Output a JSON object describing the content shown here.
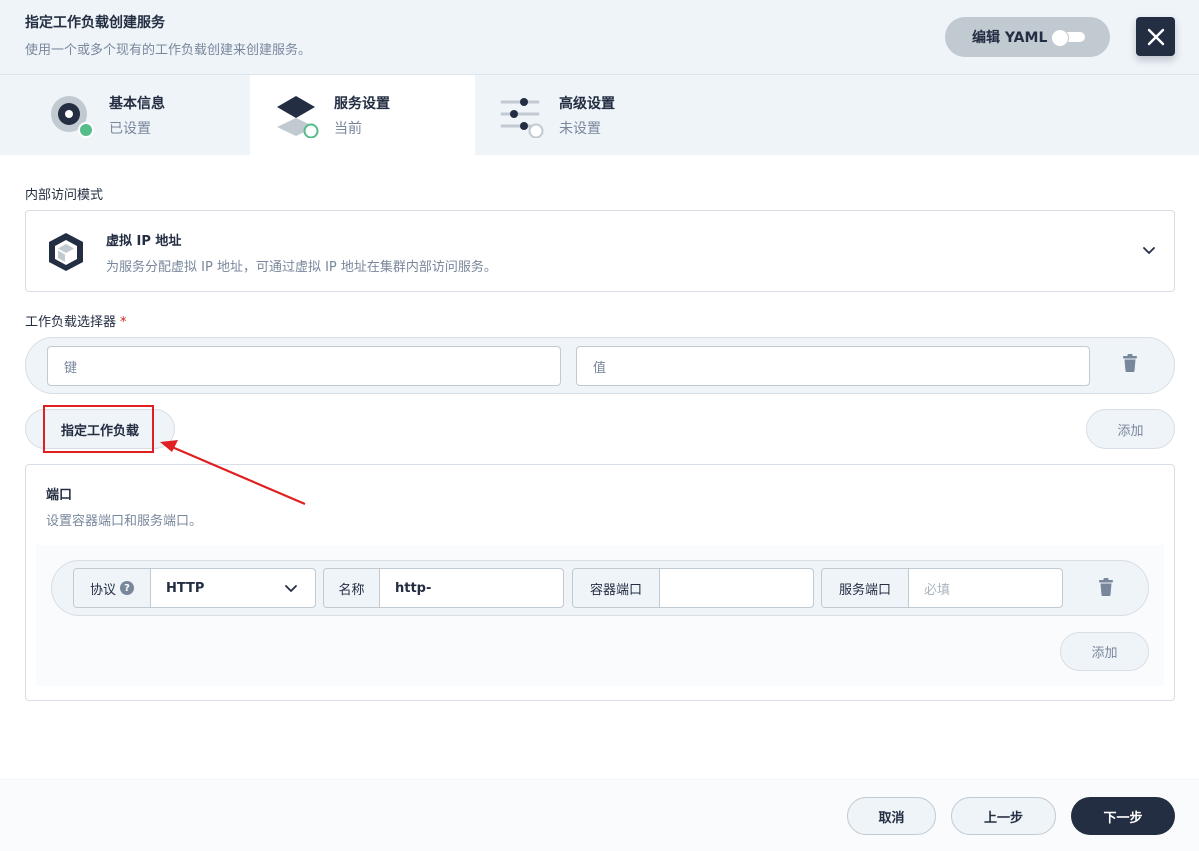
{
  "header": {
    "title": "指定工作负载创建服务",
    "description": "使用一个或多个现有的工作负载创建来创建服务。",
    "yaml_label": "编辑 YAML"
  },
  "steps": [
    {
      "title": "基本信息",
      "status": "已设置",
      "icon": "disc-icon"
    },
    {
      "title": "服务设置",
      "status": "当前",
      "icon": "layers-icon"
    },
    {
      "title": "高级设置",
      "status": "未设置",
      "icon": "sliders-icon"
    }
  ],
  "access_mode": {
    "label": "内部访问模式",
    "title": "虚拟 IP 地址",
    "description": "为服务分配虚拟 IP 地址，可通过虚拟 IP 地址在集群内部访问服务。"
  },
  "selector": {
    "label": "工作负载选择器",
    "required_mark": "*",
    "key_placeholder": "键",
    "value_placeholder": "值",
    "specify_button": "指定工作负载",
    "add_button": "添加"
  },
  "ports": {
    "title": "端口",
    "description": "设置容器端口和服务端口。",
    "protocol_label": "协议",
    "protocol_help": "?",
    "protocol_value": "HTTP",
    "name_label": "名称",
    "name_value": "http-",
    "container_port_label": "容器端口",
    "container_port_value": "",
    "service_port_label": "服务端口",
    "service_port_placeholder": "必填",
    "add_button": "添加"
  },
  "footer": {
    "cancel": "取消",
    "previous": "上一步",
    "next": "下一步"
  },
  "colors": {
    "primary_dark": "#242e42",
    "success": "#55bc8a",
    "annotation": "#e02020"
  }
}
